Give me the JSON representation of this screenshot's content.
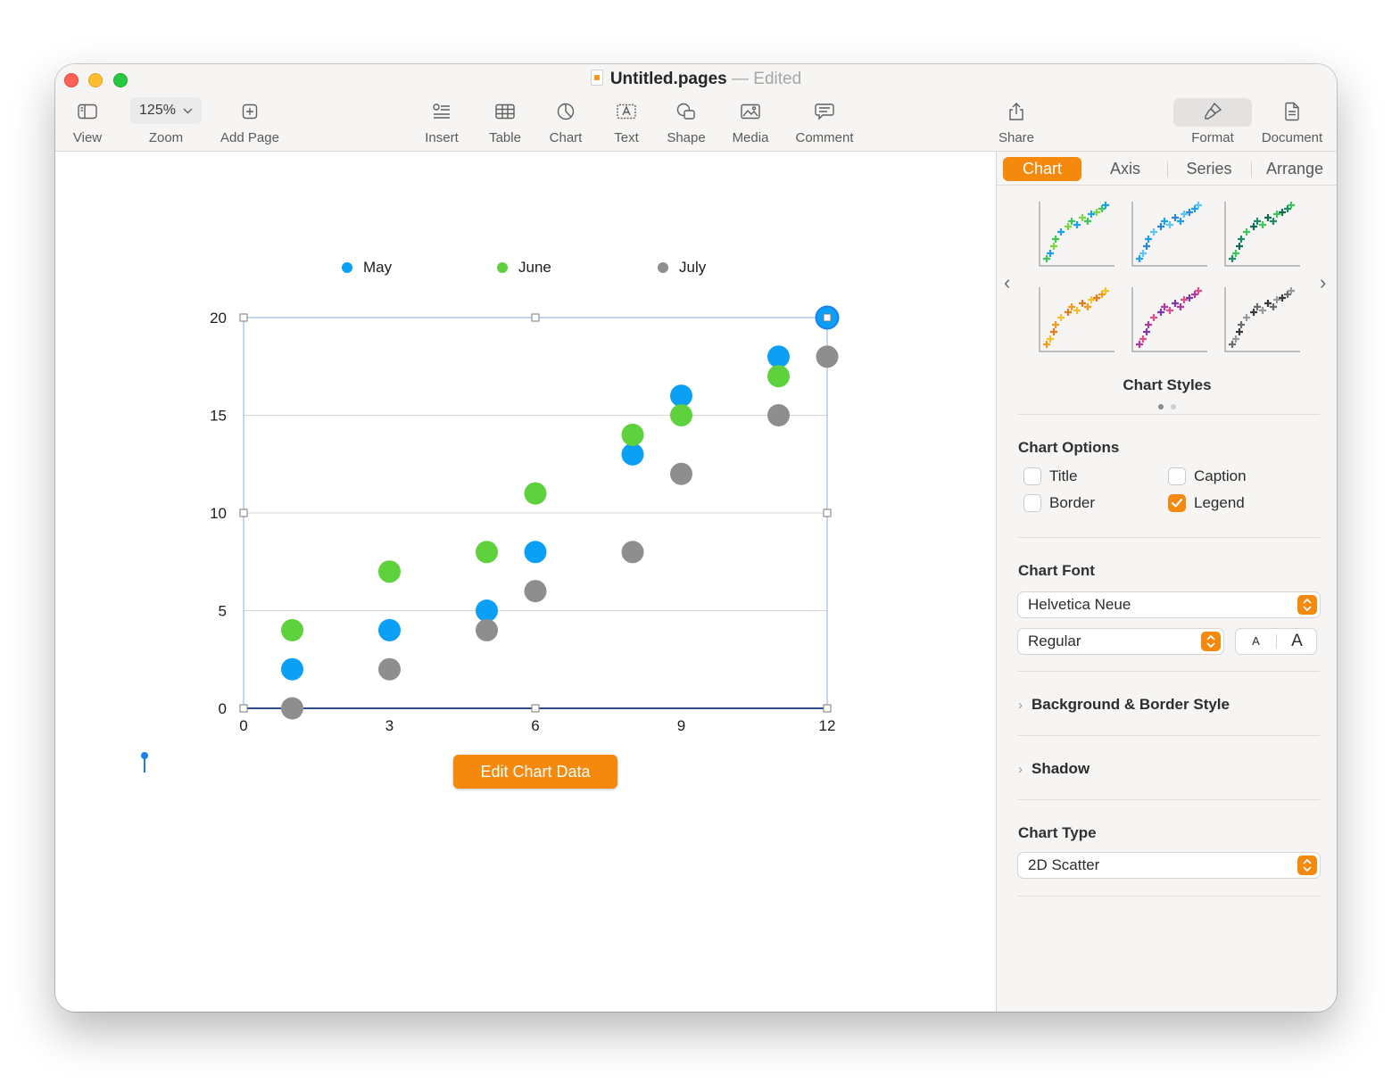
{
  "window": {
    "doc_name": "Untitled.pages",
    "separator": "—",
    "status": "Edited"
  },
  "toolbar": {
    "view_label": "View",
    "zoom_value": "125%",
    "zoom_label": "Zoom",
    "add_page_label": "Add Page",
    "insert_label": "Insert",
    "table_label": "Table",
    "chart_label": "Chart",
    "text_label": "Text",
    "shape_label": "Shape",
    "media_label": "Media",
    "comment_label": "Comment",
    "share_label": "Share",
    "format_label": "Format",
    "document_label": "Document"
  },
  "sidebar": {
    "tabs": [
      "Chart",
      "Axis",
      "Series",
      "Arrange"
    ],
    "active_tab": "Chart",
    "chart_styles_label": "Chart Styles",
    "chart_styles_page": 1,
    "chart_styles_pages": 2,
    "chart_options": {
      "heading": "Chart Options",
      "title_label": "Title",
      "title_checked": false,
      "caption_label": "Caption",
      "caption_checked": false,
      "border_label": "Border",
      "border_checked": false,
      "legend_label": "Legend",
      "legend_checked": true
    },
    "chart_font": {
      "heading": "Chart Font",
      "family": "Helvetica Neue",
      "style": "Regular",
      "smaller": "A",
      "larger": "A"
    },
    "background_border_label": "Background & Border Style",
    "shadow_label": "Shadow",
    "chart_type": {
      "heading": "Chart Type",
      "value": "2D Scatter"
    },
    "style_palettes": [
      [
        "#3ec75a",
        "#1ba1f0",
        "#7cd640"
      ],
      [
        "#1ba1f0",
        "#5cc6f8",
        "#2e86d6"
      ],
      [
        "#1e8a6c",
        "#3ec75a",
        "#136a55"
      ],
      [
        "#f49a1c",
        "#f6c12c",
        "#e97b16"
      ],
      [
        "#b03aa0",
        "#e44e8a",
        "#7a3aa8"
      ],
      [
        "#6b6b6b",
        "#9a9a9a",
        "#3a3a3a"
      ]
    ]
  },
  "canvas": {
    "edit_button_label": "Edit Chart Data"
  },
  "colors": {
    "accent": "#f4890e",
    "may": "#0b9ff5",
    "june": "#5dd23c",
    "july": "#8e8e8e"
  },
  "chart_data": {
    "type": "scatter",
    "title": "",
    "xlabel": "",
    "ylabel": "",
    "xlim": [
      0,
      12
    ],
    "ylim": [
      0,
      20
    ],
    "x_ticks": [
      "0",
      "3",
      "6",
      "9",
      "12"
    ],
    "y_ticks": [
      "0",
      "5",
      "10",
      "15",
      "20"
    ],
    "grid": "horizontal",
    "legend": "top",
    "series": [
      {
        "name": "May",
        "color": "#0b9ff5",
        "points": [
          [
            1,
            2
          ],
          [
            3,
            4
          ],
          [
            5,
            5
          ],
          [
            6,
            8
          ],
          [
            8,
            13
          ],
          [
            9,
            16
          ],
          [
            11,
            18
          ],
          [
            12,
            20
          ]
        ]
      },
      {
        "name": "June",
        "color": "#5dd23c",
        "points": [
          [
            1,
            4
          ],
          [
            3,
            7
          ],
          [
            5,
            8
          ],
          [
            6,
            11
          ],
          [
            8,
            14
          ],
          [
            9,
            15
          ],
          [
            11,
            17
          ]
        ]
      },
      {
        "name": "July",
        "color": "#8e8e8e",
        "points": [
          [
            1,
            0
          ],
          [
            3,
            2
          ],
          [
            5,
            4
          ],
          [
            6,
            6
          ],
          [
            8,
            8
          ],
          [
            9,
            12
          ],
          [
            11,
            15
          ],
          [
            12,
            18
          ]
        ]
      }
    ]
  }
}
